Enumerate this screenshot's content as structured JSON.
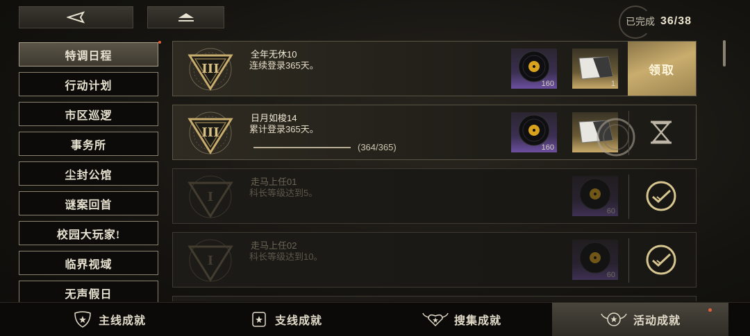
{
  "header": {
    "back_icon": "back-arrow-icon",
    "home_icon": "eject-home-icon",
    "progress_label": "已完成",
    "progress_count": "36/38"
  },
  "sidebar": {
    "items": [
      {
        "label": "特调日程",
        "active": true
      },
      {
        "label": "行动计划"
      },
      {
        "label": "市区巡逻"
      },
      {
        "label": "事务所"
      },
      {
        "label": "尘封公馆"
      },
      {
        "label": "谜案回首"
      },
      {
        "label": "校园大玩家!"
      },
      {
        "label": "临界视域"
      },
      {
        "label": "无声假日"
      }
    ]
  },
  "achievements": [
    {
      "title": "全年无休10",
      "desc": "连续登录365天。",
      "state": "claimable",
      "action_label": "领取",
      "rewards": [
        {
          "icon": "vinyl-record-icon",
          "qty": "160"
        },
        {
          "icon": "card-ticket-icon",
          "qty": "1"
        }
      ]
    },
    {
      "title": "日月如梭14",
      "desc": "累计登录365天。",
      "state": "in-progress",
      "progress_text": "(364/365)",
      "progress": 0.997,
      "rewards": [
        {
          "icon": "vinyl-record-icon",
          "qty": "160"
        },
        {
          "icon": "card-ticket-icon",
          "qty": ""
        }
      ]
    },
    {
      "title": "走马上任01",
      "desc": "科长等级达到5。",
      "state": "completed",
      "rewards": [
        {
          "icon": "vinyl-record-icon",
          "qty": "60"
        }
      ]
    },
    {
      "title": "走马上任02",
      "desc": "科长等级达到10。",
      "state": "completed",
      "rewards": [
        {
          "icon": "vinyl-record-icon",
          "qty": "60"
        }
      ]
    }
  ],
  "tabs": [
    {
      "label": "主线成就",
      "icon": "shield-star-icon"
    },
    {
      "label": "支线成就",
      "icon": "badge-star-icon"
    },
    {
      "label": "搜集成就",
      "icon": "winged-heart-icon"
    },
    {
      "label": "活动成就",
      "icon": "winged-badge-icon",
      "active": true
    }
  ],
  "colors": {
    "accent_gold": "#c9ad6e",
    "notify_dot": "#e4603a",
    "rare_purple": "#6c4fa0"
  }
}
